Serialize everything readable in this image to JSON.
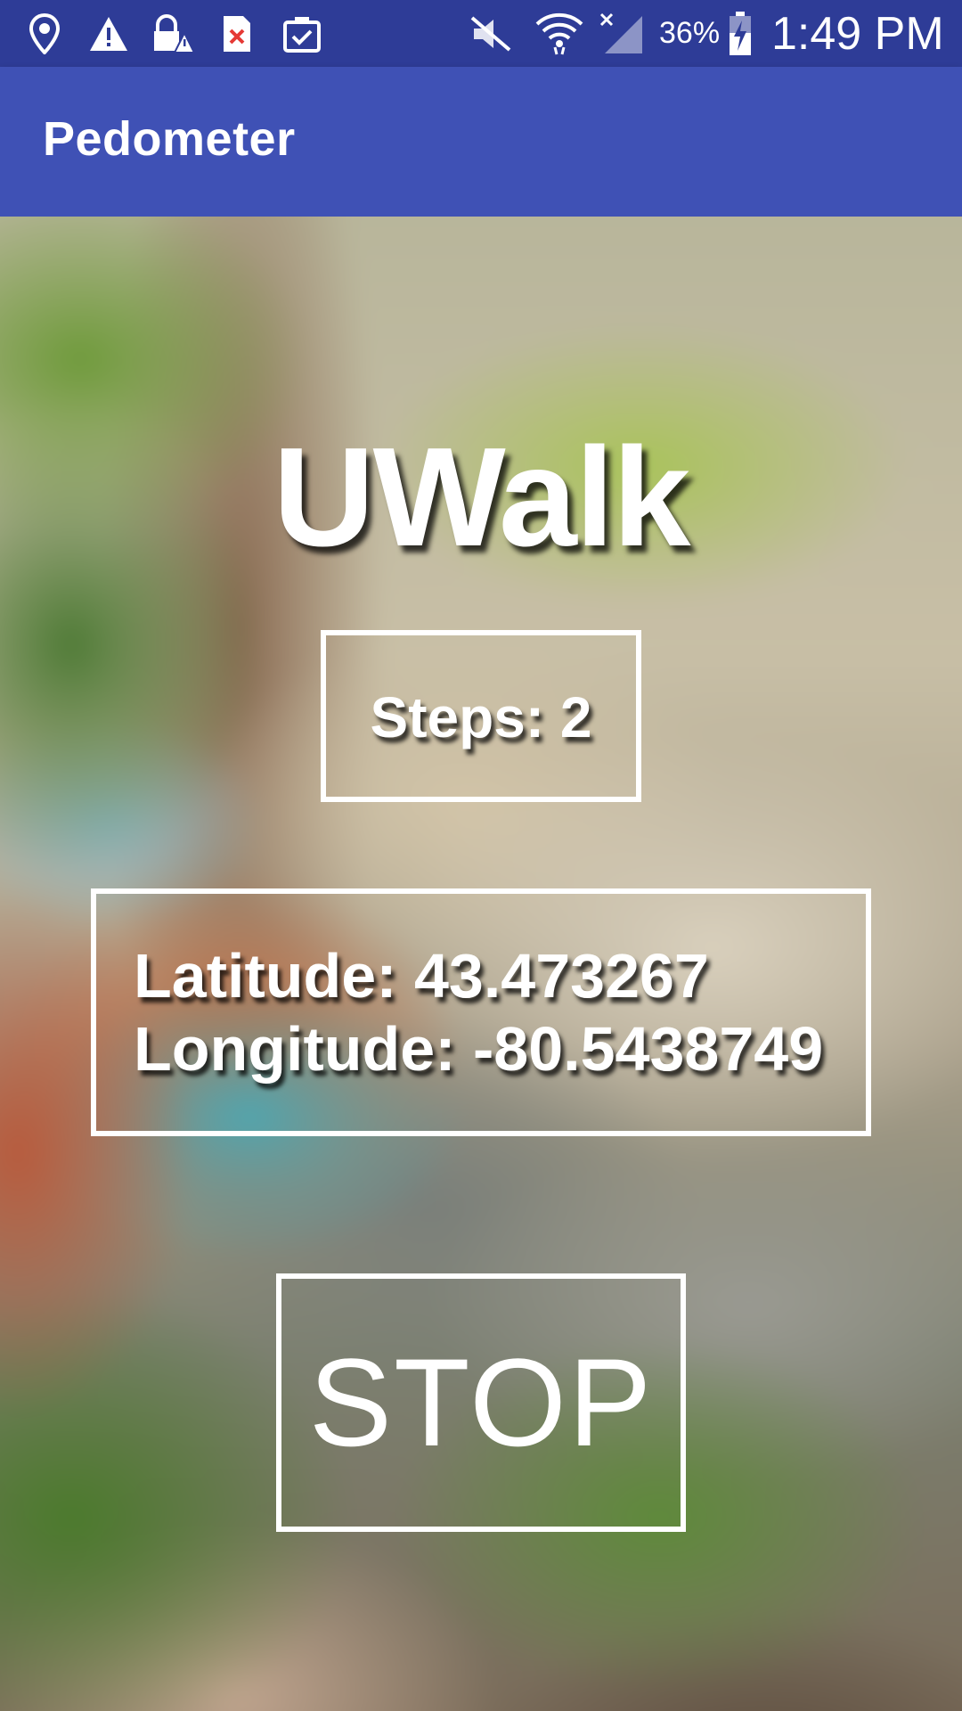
{
  "status_bar": {
    "battery_percent": "36%",
    "time": "1:49 PM",
    "icons": [
      "location-icon",
      "warning-icon",
      "lock-warning-icon",
      "sim-error-icon",
      "clipboard-check-icon",
      "mute-icon",
      "wifi-icon",
      "no-signal-icon",
      "battery-charging-icon"
    ]
  },
  "app_bar": {
    "title": "Pedometer"
  },
  "main": {
    "title": "UWalk",
    "steps_text": "Steps: 2",
    "latitude_text": "Latitude: 43.473267",
    "longitude_text": "Longitude: -80.5438749",
    "stop_label": "STOP"
  },
  "colors": {
    "status_bar": "#2e3c97",
    "app_bar": "#3f51b5",
    "text": "#ffffff"
  }
}
